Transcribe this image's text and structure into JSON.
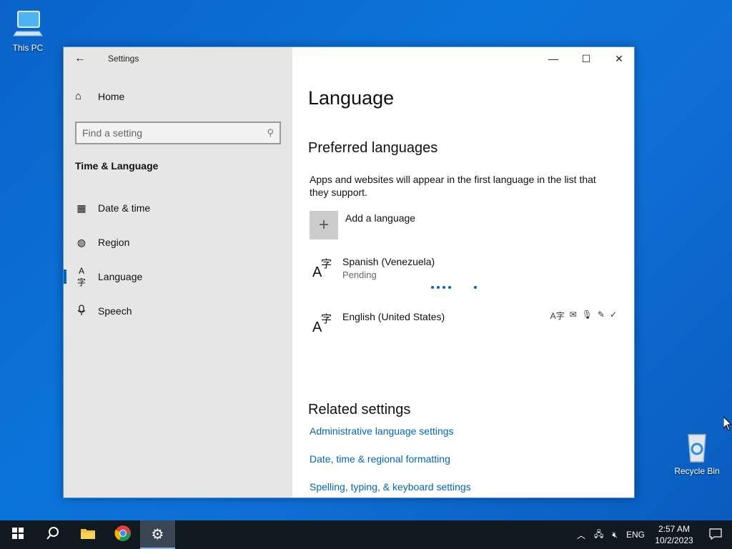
{
  "desktop": {
    "icons": [
      {
        "label": "This PC",
        "icon": "computer-icon"
      },
      {
        "label": "Recycle Bin",
        "icon": "recycle-bin-icon"
      }
    ]
  },
  "window": {
    "title": "Settings",
    "back_icon": "back-arrow-icon",
    "controls": {
      "minimize": "—",
      "maximize": "☐",
      "close": "✕"
    }
  },
  "sidebar": {
    "home_label": "Home",
    "search": {
      "placeholder": "Find a setting",
      "value": ""
    },
    "section_title": "Time & Language",
    "items": [
      {
        "label": "Date & time",
        "icon": "calendar-clock-icon",
        "selected": false
      },
      {
        "label": "Region",
        "icon": "globe-icon",
        "selected": false
      },
      {
        "label": "Language",
        "icon": "language-icon",
        "selected": true
      },
      {
        "label": "Speech",
        "icon": "microphone-icon",
        "selected": false
      }
    ]
  },
  "main": {
    "page_title": "Language",
    "preferred_heading": "Preferred languages",
    "preferred_description": "Apps and websites will appear in the first language in the list that they support.",
    "add_language_label": "Add a language",
    "languages": [
      {
        "name": "Spanish (Venezuela)",
        "status": "Pending",
        "features": []
      },
      {
        "name": "English (United States)",
        "status": "",
        "features": [
          "display-language-icon",
          "text-to-speech-icon",
          "speech-icon",
          "handwriting-icon",
          "spell-check-icon"
        ]
      }
    ],
    "related_heading": "Related settings",
    "related_links": [
      "Administrative language settings",
      "Date, time & regional formatting",
      "Spelling, typing, & keyboard settings"
    ]
  },
  "taskbar": {
    "items": [
      "start-icon",
      "search-icon",
      "file-explorer-icon",
      "chrome-icon",
      "settings-icon"
    ],
    "active_item": "settings-icon",
    "tray": {
      "input_language": "ENG",
      "time": "2:57 AM",
      "date": "10/2/2023"
    }
  },
  "colors": {
    "accent": "#0067c0",
    "link": "#0067b8",
    "sidebar_bg": "#e6e6e6",
    "taskbar_bg": "#101820"
  }
}
